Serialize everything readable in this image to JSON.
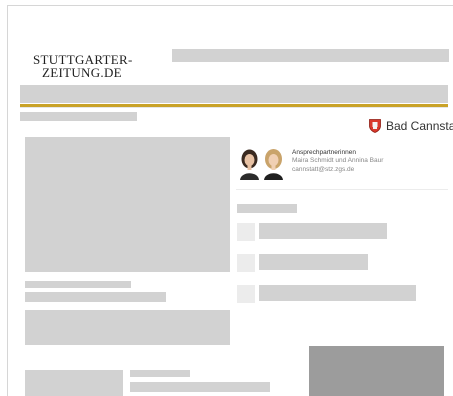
{
  "header": {
    "logo_line1": "STUTTGARTER-",
    "logo_line2": "ZEITUNG.DE"
  },
  "location": {
    "name": "Bad Cannstatt",
    "crest_color": "#d9392c",
    "crest_icon": "coat-of-arms-icon"
  },
  "contact": {
    "title": "Ansprechpartnerinnen",
    "names": "Maira Schmidt und Annina Baur",
    "email": "cannstatt@stz.zgs.de"
  },
  "colors": {
    "accent_line": "#c9a227",
    "placeholder": "#d2d2d2"
  }
}
